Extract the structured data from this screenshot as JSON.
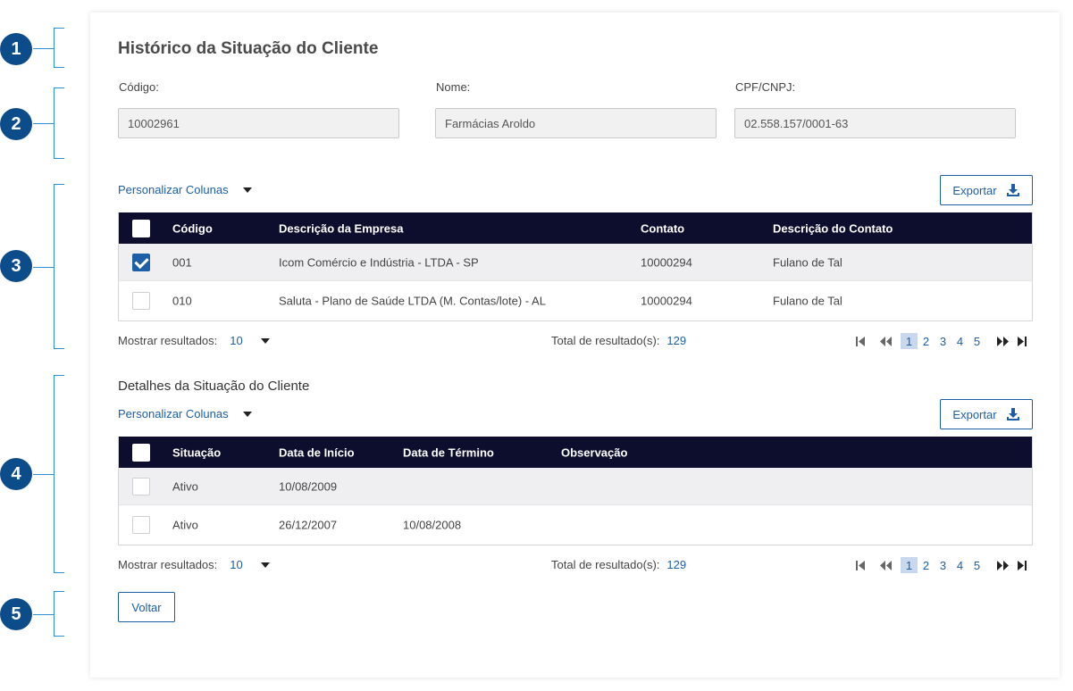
{
  "markers": [
    "1",
    "2",
    "3",
    "4",
    "5"
  ],
  "page_title": "Histórico da Situação do Cliente",
  "fields": {
    "codigo": {
      "label": "Código:",
      "value": "10002961"
    },
    "nome": {
      "label": "Nome:",
      "value": "Farmácias Aroldo"
    },
    "cpf": {
      "label": "CPF/CNPJ:",
      "value": "02.558.157/0001-63"
    }
  },
  "history": {
    "customize_label": "Personalizar Colunas",
    "export_label": "Exportar",
    "columns": [
      "Código",
      "Descrição da Empresa",
      "Contato",
      "Descrição do Contato"
    ],
    "rows": [
      {
        "checked": true,
        "codigo": "001",
        "empresa": "Icom Comércio e Indústria - LTDA - SP",
        "contato": "10000294",
        "desc_contato": "Fulano de Tal"
      },
      {
        "checked": false,
        "codigo": "010",
        "empresa": "Saluta - Plano de Saúde LTDA (M. Contas/lote) - AL",
        "contato": "10000294",
        "desc_contato": "Fulano de Tal"
      }
    ],
    "show_label": "Mostrar resultados:",
    "show_value": "10",
    "total_label": "Total de resultado(s):",
    "total_value": "129",
    "pages": [
      "1",
      "2",
      "3",
      "4",
      "5"
    ]
  },
  "details": {
    "subtitle": "Detalhes da Situação do Cliente",
    "customize_label": "Personalizar Colunas",
    "export_label": "Exportar",
    "columns": [
      "Situação",
      "Data de Início",
      "Data de Término",
      "Observação"
    ],
    "rows": [
      {
        "checked": false,
        "situacao": "Ativo",
        "inicio": "10/08/2009",
        "termino": "",
        "obs": ""
      },
      {
        "checked": false,
        "situacao": "Ativo",
        "inicio": "26/12/2007",
        "termino": "10/08/2008",
        "obs": ""
      }
    ],
    "show_label": "Mostrar resultados:",
    "show_value": "10",
    "total_label": "Total de resultado(s):",
    "total_value": "129",
    "pages": [
      "1",
      "2",
      "3",
      "4",
      "5"
    ]
  },
  "back_label": "Voltar",
  "colors": {
    "primary": "#1c5fa6",
    "header_bg": "#0d0e2d",
    "marker": "#0d4c8b",
    "bracket": "#2d8fd6"
  },
  "icons": {
    "export": "download-icon",
    "first": "first-page-icon",
    "prev": "rewind-icon",
    "next": "fast-forward-icon",
    "last": "last-page-icon"
  }
}
